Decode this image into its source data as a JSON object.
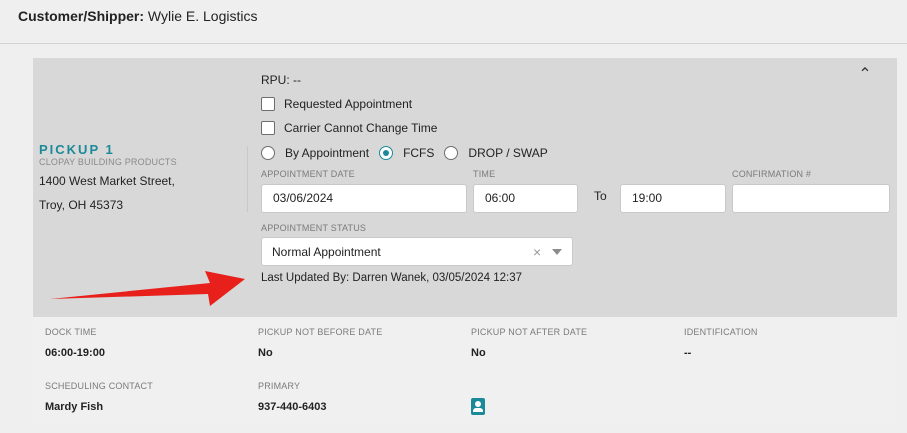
{
  "header": {
    "customer_label": "Customer/Shipper:",
    "customer_value": "Wylie E. Logistics"
  },
  "pickup": {
    "title": "PICKUP 1",
    "company": "CLOPAY BUILDING PRODUCTS",
    "address_line1": "1400 West Market Street,",
    "address_line2": "Troy, OH 45373"
  },
  "rpu": "RPU: --",
  "checkboxes": {
    "requested_appointment": "Requested Appointment",
    "carrier_cannot_change_time": "Carrier Cannot Change Time"
  },
  "appointment_type": {
    "options": [
      "By Appointment",
      "FCFS",
      "DROP / SWAP"
    ],
    "selected": "FCFS"
  },
  "fields": {
    "appointment_date_label": "APPOINTMENT DATE",
    "appointment_date": "03/06/2024",
    "time_label": "TIME",
    "time_from": "06:00",
    "to_label": "To",
    "time_to": "19:00",
    "confirmation_label": "CONFIRMATION #",
    "confirmation_value": ""
  },
  "appointment_status": {
    "label": "APPOINTMENT STATUS",
    "value": "Normal Appointment"
  },
  "last_updated": "Last Updated By: Darren Wanek, 03/05/2024 12:37",
  "details": {
    "dock_time_label": "DOCK TIME",
    "dock_time": "06:00-19:00",
    "not_before_label": "PICKUP NOT BEFORE DATE",
    "not_before": "No",
    "not_after_label": "PICKUP NOT AFTER DATE",
    "not_after": "No",
    "identification_label": "IDENTIFICATION",
    "identification": "--",
    "scheduling_contact_label": "SCHEDULING CONTACT",
    "scheduling_contact": "Mardy Fish",
    "primary_label": "PRIMARY",
    "primary": "937-440-6403"
  },
  "colors": {
    "accent": "#1b8a98",
    "arrow": "#e8201b"
  },
  "icons": {
    "collapse": "chevron-up-icon",
    "contact": "contact-card-icon",
    "clear": "clear-x-icon",
    "dropdown": "caret-down-icon"
  }
}
